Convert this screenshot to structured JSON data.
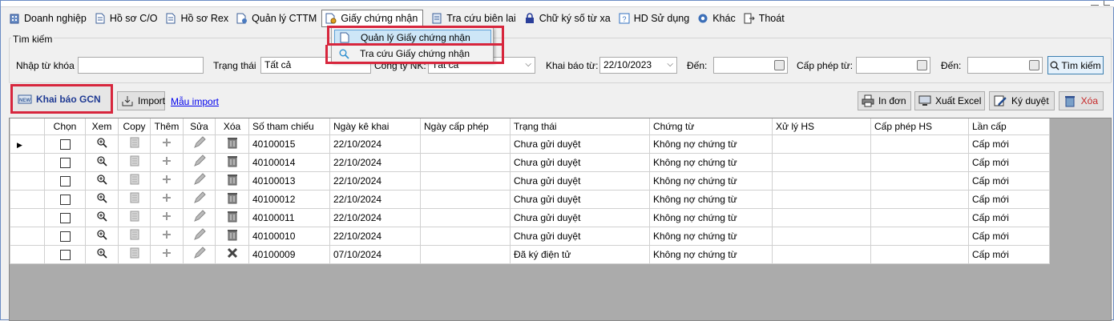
{
  "menu": [
    {
      "label": "Doanh nghiệp",
      "icon": "building-icon"
    },
    {
      "label": "Hồ sơ C/O",
      "icon": "document-icon"
    },
    {
      "label": "Hồ sơ Rex",
      "icon": "document-icon"
    },
    {
      "label": "Quản lý CTTM",
      "icon": "document-settings-icon"
    },
    {
      "label": "Giấy chứng nhận",
      "icon": "certificate-icon"
    },
    {
      "label": "Tra cứu biên lai",
      "icon": "receipt-icon"
    },
    {
      "label": "Chữ ký số từ xa",
      "icon": "lock-icon"
    },
    {
      "label": "HD Sử dụng",
      "icon": "help-icon"
    },
    {
      "label": "Khác",
      "icon": "gear-icon"
    },
    {
      "label": "Thoát",
      "icon": "exit-icon"
    }
  ],
  "dropdown": {
    "items": [
      "Quản lý Giấy chứng nhận",
      "Tra cứu Giấy chứng nhận"
    ]
  },
  "search": {
    "group_title": "Tìm kiếm",
    "keyword_label": "Nhập từ khóa",
    "keyword_value": "",
    "status_label": "Trạng thái",
    "status_value": "Tất cả",
    "company_label": "Công ty NK:",
    "company_value": "Tất cả",
    "declare_from_label": "Khai báo từ:",
    "declare_from_value": "22/10/2023",
    "to_label": "Đến:",
    "to_value": "",
    "permit_from_label": "Cấp phép từ:",
    "permit_from_value": "",
    "permit_to_label": "Đến:",
    "permit_to_value": "",
    "search_button": "Tìm kiếm"
  },
  "toolbar": {
    "declare_button": "Khai báo GCN",
    "import_button": "Import",
    "template_link": "Mẫu import",
    "print_button": "In đơn",
    "export_button": "Xuất Excel",
    "approve_button": "Ký duyệt",
    "delete_button": "Xóa"
  },
  "table": {
    "columns": [
      "Chọn",
      "Xem",
      "Copy",
      "Thêm",
      "Sửa",
      "Xóa",
      "Số tham chiếu",
      "Ngày kê khai",
      "Ngày cấp phép",
      "Trạng thái",
      "Chứng từ",
      "Xử lý HS",
      "Cấp phép HS",
      "Lần cấp"
    ],
    "rows": [
      {
        "ref": "40100015",
        "date": "22/10/2024",
        "permit_date": "",
        "status": "Chưa gửi duyệt",
        "doc": "Không nợ chứng từ",
        "handle": "",
        "permit": "",
        "times": "Cấp mới",
        "delete_icon": "trash-icon"
      },
      {
        "ref": "40100014",
        "date": "22/10/2024",
        "permit_date": "",
        "status": "Chưa gửi duyệt",
        "doc": "Không nợ chứng từ",
        "handle": "",
        "permit": "",
        "times": "Cấp mới",
        "delete_icon": "trash-icon"
      },
      {
        "ref": "40100013",
        "date": "22/10/2024",
        "permit_date": "",
        "status": "Chưa gửi duyệt",
        "doc": "Không nợ chứng từ",
        "handle": "",
        "permit": "",
        "times": "Cấp mới",
        "delete_icon": "trash-icon"
      },
      {
        "ref": "40100012",
        "date": "22/10/2024",
        "permit_date": "",
        "status": "Chưa gửi duyệt",
        "doc": "Không nợ chứng từ",
        "handle": "",
        "permit": "",
        "times": "Cấp mới",
        "delete_icon": "trash-icon"
      },
      {
        "ref": "40100011",
        "date": "22/10/2024",
        "permit_date": "",
        "status": "Chưa gửi duyệt",
        "doc": "Không nợ chứng từ",
        "handle": "",
        "permit": "",
        "times": "Cấp mới",
        "delete_icon": "trash-icon"
      },
      {
        "ref": "40100010",
        "date": "22/10/2024",
        "permit_date": "",
        "status": "Chưa gửi duyệt",
        "doc": "Không nợ chứng từ",
        "handle": "",
        "permit": "",
        "times": "Cấp mới",
        "delete_icon": "trash-icon"
      },
      {
        "ref": "40100009",
        "date": "07/10/2024",
        "permit_date": "",
        "status": "Đã ký điện tử",
        "doc": "Không nợ chứng từ",
        "handle": "",
        "permit": "",
        "times": "Cấp mới",
        "delete_icon": "cross-icon"
      }
    ]
  },
  "colors": {
    "highlight": "#d7263d",
    "accent": "#1f3a93",
    "grid_bg": "#ababab",
    "selected_item": "#cde6f7"
  }
}
